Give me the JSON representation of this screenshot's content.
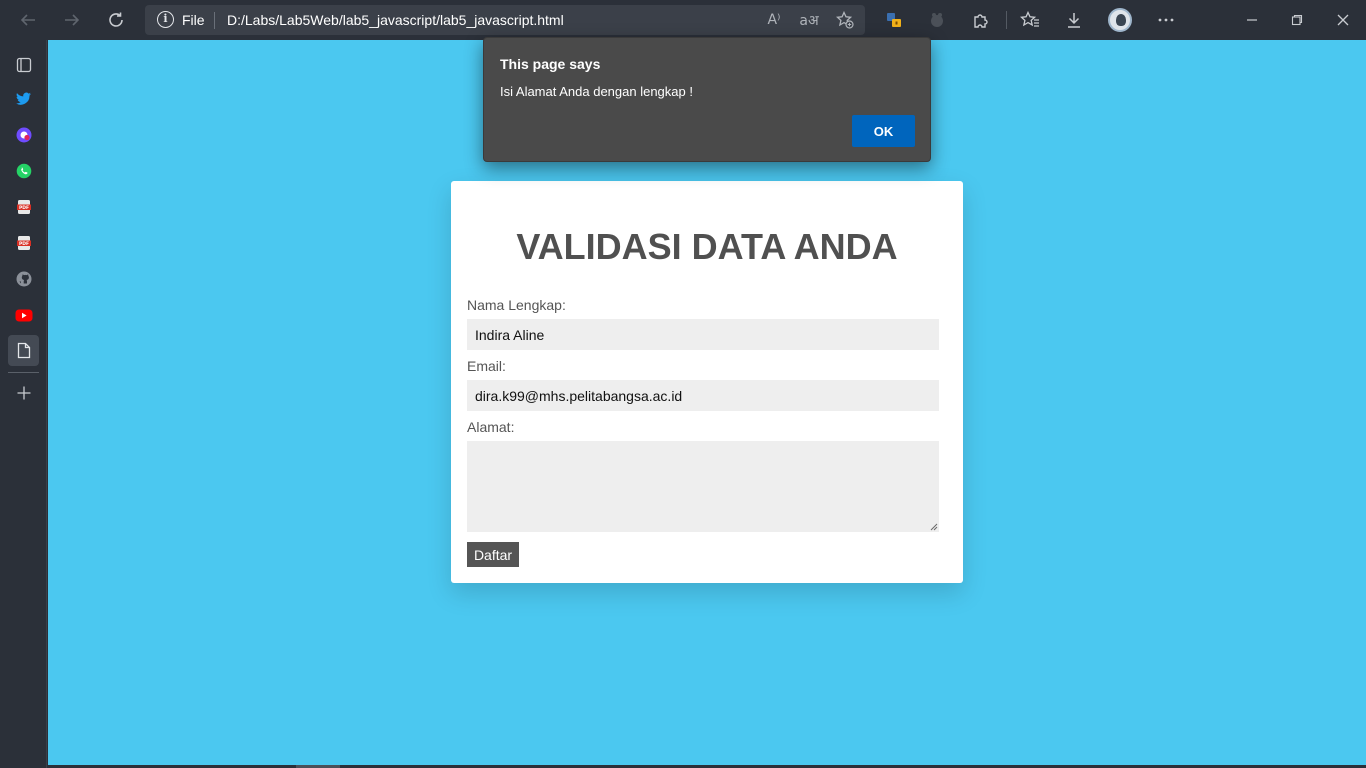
{
  "browser": {
    "address_scheme": "File",
    "address_url": "D:/Labs/Lab5Web/lab5_javascript/lab5_javascript.html",
    "info_glyph": "i",
    "read_aloud_glyph": "A⁾",
    "translate_glyph": "aअ"
  },
  "form": {
    "title": "VALIDASI DATA ANDA",
    "name_label": "Nama Lengkap:",
    "name_value": "Indira Aline",
    "email_label": "Email:",
    "email_value": "dira.k99@mhs.pelitabangsa.ac.id",
    "address_label": "Alamat:",
    "address_value": "",
    "submit_label": "Daftar"
  },
  "dialog": {
    "title": "This page says",
    "message": "Isi Alamat Anda dengan lengkap !",
    "ok_label": "OK"
  },
  "colors": {
    "page_background": "#4bc8f0",
    "browser_chrome": "#2b3039",
    "dialog_background": "#4a4a4a",
    "ok_button": "#0065bd",
    "submit_button": "#555555"
  }
}
